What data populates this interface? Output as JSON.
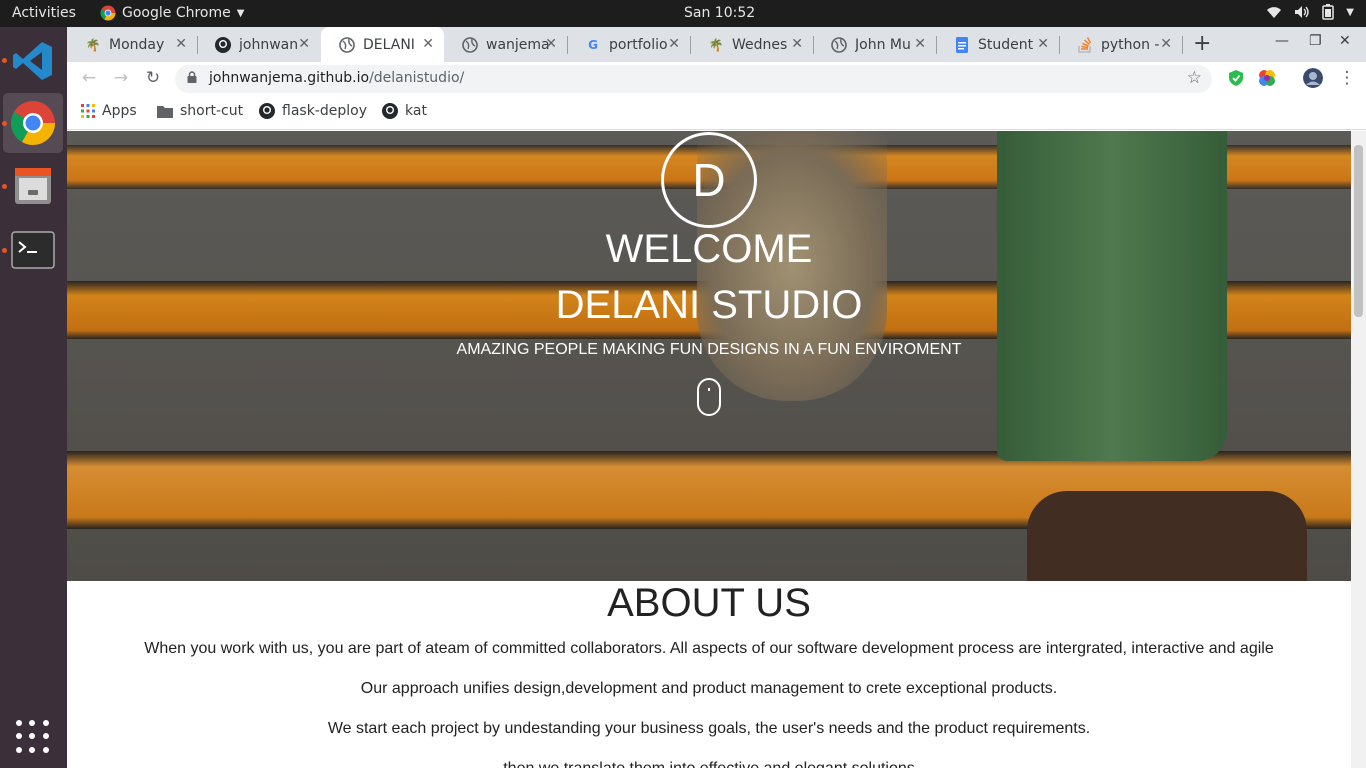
{
  "system": {
    "activities": "Activities",
    "app_name": "Google Chrome",
    "clock": "San 10:52"
  },
  "dock": [
    "vscode-icon",
    "chrome-icon",
    "files-icon",
    "terminal-icon"
  ],
  "tabs": [
    {
      "title": "Monday",
      "icon": "palm-icon"
    },
    {
      "title": "johnwan",
      "icon": "github-icon"
    },
    {
      "title": "DELANI",
      "icon": "globe-icon",
      "active": true
    },
    {
      "title": "wanjema",
      "icon": "globe-icon"
    },
    {
      "title": "portfolio",
      "icon": "google-icon"
    },
    {
      "title": "Wednes",
      "icon": "palm-icon"
    },
    {
      "title": "John Mu",
      "icon": "globe-icon"
    },
    {
      "title": "Student",
      "icon": "docs-icon"
    },
    {
      "title": "python -",
      "icon": "stackoverflow-icon"
    }
  ],
  "address": {
    "host": "johnwanjema.github.io",
    "path": "/delanistudio/"
  },
  "bookmarks": [
    {
      "label": "Apps",
      "icon": "apps-grid-icon"
    },
    {
      "label": "short-cut",
      "icon": "folder-icon"
    },
    {
      "label": "flask-deploy",
      "icon": "github-icon"
    },
    {
      "label": "kat",
      "icon": "github-icon"
    }
  ],
  "hero": {
    "logo_letter": "D",
    "welcome": "WELCOME",
    "studio": "DELANI STUDIO",
    "tagline": "AMAZING PEOPLE MAKING FUN DESIGNS IN A FUN ENVIROMENT"
  },
  "about": {
    "title": "ABOUT US",
    "paragraphs": [
      "When you work with us, you are part of ateam of committed collaborators. All aspects of our software development process are intergrated, interactive and agile",
      "Our approach unifies design,development and product management to crete exceptional products.",
      "We start each project by undestanding your business goals, the user's needs and the product requirements.",
      "then we translate them into effective and elegant solutions"
    ]
  },
  "colors": {
    "accent_orange": "#e95420",
    "stair_orange": "#f0961e"
  }
}
